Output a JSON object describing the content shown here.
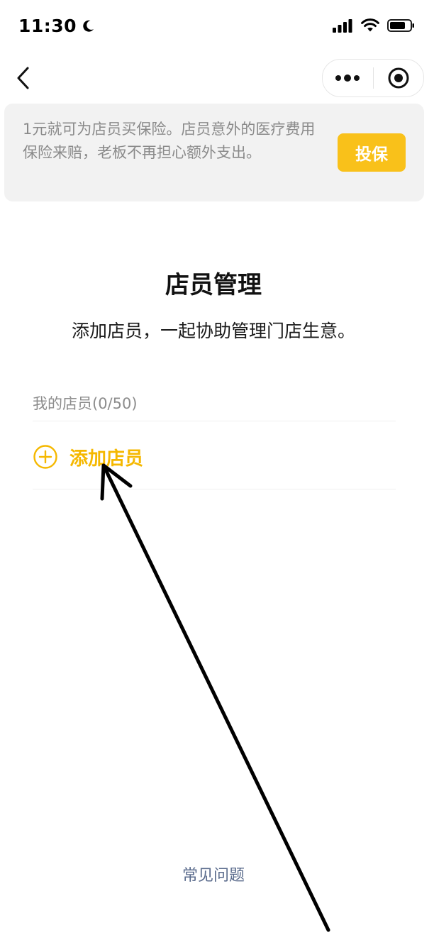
{
  "status_bar": {
    "time": "11:30"
  },
  "nav": {
    "back_icon": "chevron-left-icon",
    "more_icon": "more-dots-icon",
    "close_icon": "target-circle-icon"
  },
  "banner": {
    "text": "1元就可为店员买保险。店员意外的医疗费用保险来赔，老板不再担心额外支出。",
    "button_label": "投保",
    "button_color": "#f9c11a"
  },
  "main": {
    "title": "店员管理",
    "subtitle": "添加店员，一起协助管理门店生意。",
    "staff_section_label": "我的店员(0/50)",
    "add_staff_label": "添加店员",
    "accent_color": "#f5b800"
  },
  "footer": {
    "faq_label": "常见问题"
  }
}
